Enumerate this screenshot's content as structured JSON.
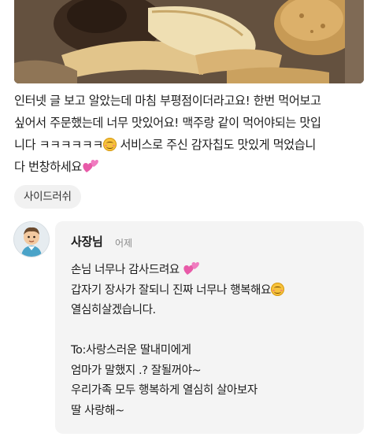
{
  "review": {
    "photo_icon": "food-photo",
    "lines": [
      "인터넷 글 보고 알았는데 마침 부평점이더라고요! 한번 먹어보고",
      "싶어서 주문했는데 너무 맛있어요! 맥주랑 같이 먹어야되는 맛입",
      "니다 ㅋㅋㅋㅋㅋㅋ",
      " 서비스로 주신 감자칩도 맛있게 먹었습니",
      "다 번창하세요"
    ],
    "emoji_smile": "smiling-face-emoji",
    "emoji_hearts": "two-hearts-emoji"
  },
  "tag": {
    "label": "사이드러쉬"
  },
  "reply": {
    "author": "사장님",
    "time": "어제",
    "lines": [
      "손님 너무나 감사드려요",
      "갑자기  장사가 잘되니 진짜 너무나 행복해요",
      "열심히살겠습니다.",
      "",
      "To:사랑스러운 딸내미에게",
      "엄마가 말했지 .?  잘될꺼야~",
      "우리가족 모두 행복하게 열심히 살아보자",
      "딸 사랑해~"
    ]
  },
  "colors": {
    "heart": "#e85aa8",
    "smile": "#f7c23b",
    "reply_bg": "#f4f4f4",
    "tag_bg": "#f1f1f1"
  }
}
